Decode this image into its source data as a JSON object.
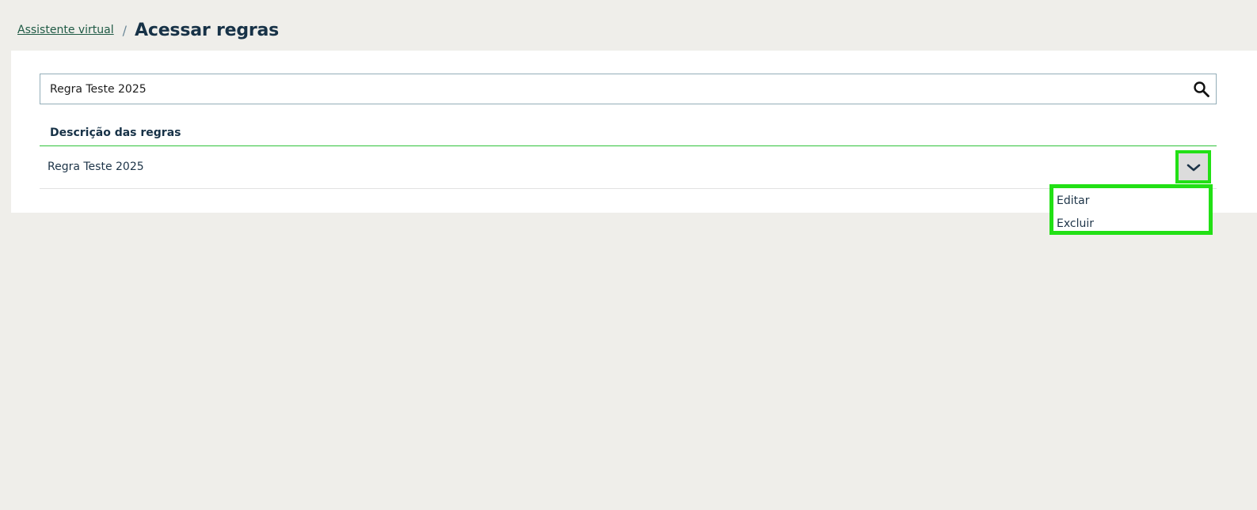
{
  "breadcrumb": {
    "parent_label": "Assistente virtual",
    "separator": "/",
    "current_label": "Acessar regras"
  },
  "search": {
    "value": "Regra Teste 2025",
    "icon": "search-icon"
  },
  "table": {
    "column_header": "Descrição das regras",
    "rows": [
      {
        "label": "Regra Teste 2025"
      }
    ]
  },
  "row_menu": {
    "toggle_icon": "chevron-down-icon",
    "items": [
      {
        "label": "Editar"
      },
      {
        "label": "Excluir"
      }
    ]
  },
  "colors": {
    "page_background": "#efeeea",
    "card_background": "#ffffff",
    "heading_text": "#173247",
    "link_text": "#1f5a45",
    "accent_green": "#2fc23a",
    "highlight_green": "#22e015"
  }
}
